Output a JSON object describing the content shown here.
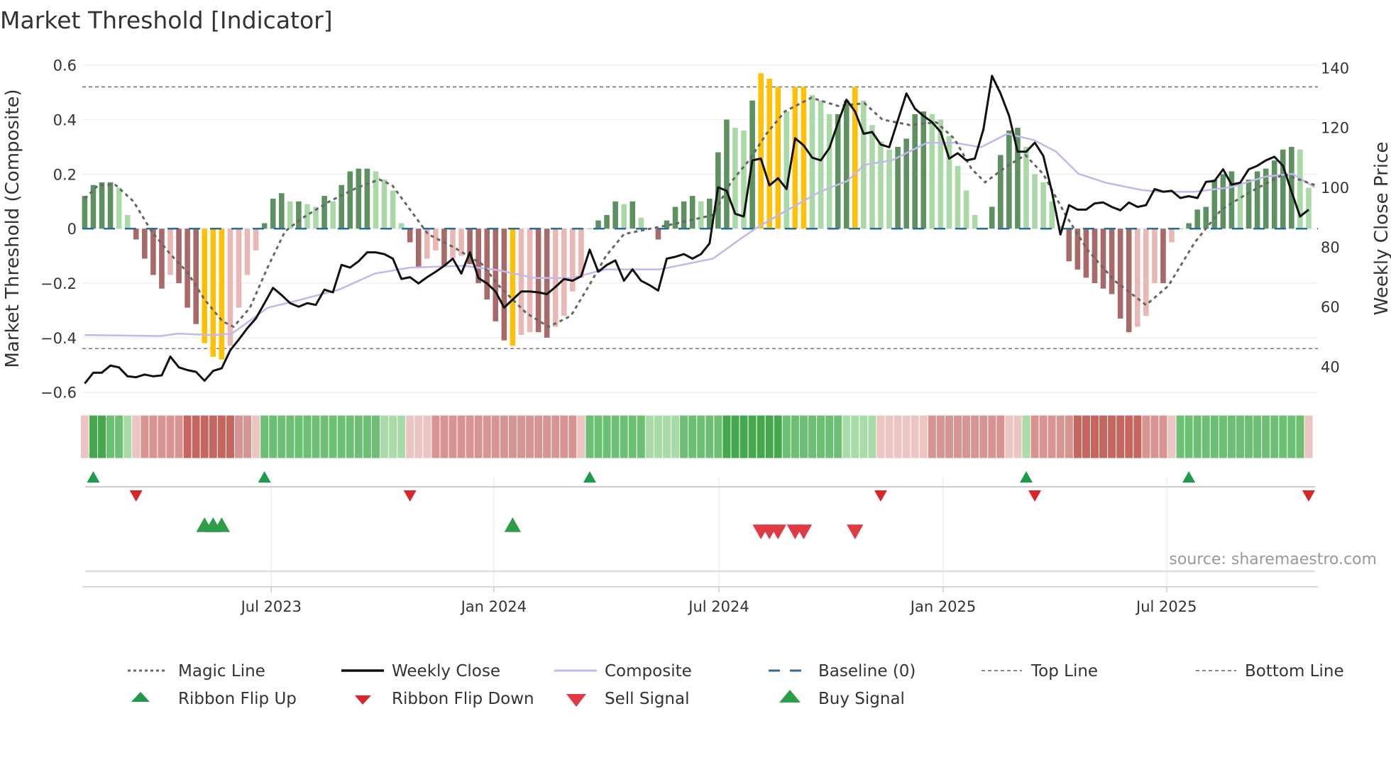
{
  "chart_data": {
    "type": "bar",
    "title": "Market Threshold [Indicator]",
    "ylabel_left": "Market Threshold (Composite)",
    "ylabel_right": "Weekly Close Price",
    "ylim_left": [
      -0.6,
      0.6
    ],
    "ylim_right": [
      30,
      145
    ],
    "yticks_left": [
      {
        "value": 0.6,
        "label": "0.6"
      },
      {
        "value": 0.4,
        "label": "0.4"
      },
      {
        "value": 0.2,
        "label": "0.2"
      },
      {
        "value": 0,
        "label": "0"
      },
      {
        "value": -0.2,
        "label": "−0.2"
      },
      {
        "value": -0.4,
        "label": "−0.4"
      },
      {
        "value": -0.6,
        "label": "−0.6"
      }
    ],
    "yticks_right": [
      {
        "value": 140,
        "label": "140"
      },
      {
        "value": 120,
        "label": "120"
      },
      {
        "value": 100,
        "label": "100"
      },
      {
        "value": 80,
        "label": "80"
      },
      {
        "value": 60,
        "label": "60"
      },
      {
        "value": 40,
        "label": "40"
      }
    ],
    "x_unit": "week index",
    "x_ticks": [
      {
        "week": 21.8,
        "label": "Jul 2023"
      },
      {
        "week": 47.8,
        "label": "Jan 2024"
      },
      {
        "week": 74.1,
        "label": "Jul 2024"
      },
      {
        "week": 100.3,
        "label": "Jan 2025"
      },
      {
        "week": 126.4,
        "label": "Jul 2025"
      }
    ],
    "top_line": 0.52,
    "bottom_line": -0.44,
    "baseline": 0,
    "histogram": [
      0.12,
      0.16,
      0.17,
      0.17,
      0.15,
      0.05,
      -0.04,
      -0.11,
      -0.17,
      -0.22,
      -0.17,
      -0.2,
      -0.29,
      -0.35,
      -0.42,
      -0.47,
      -0.48,
      -0.43,
      -0.29,
      -0.17,
      -0.08,
      0.02,
      0.11,
      0.13,
      0.1,
      0.1,
      0.09,
      0.08,
      0.12,
      0.1,
      0.16,
      0.21,
      0.22,
      0.22,
      0.21,
      0.18,
      0.14,
      0.02,
      -0.05,
      -0.14,
      -0.11,
      -0.08,
      -0.14,
      -0.11,
      -0.1,
      -0.13,
      -0.2,
      -0.26,
      -0.34,
      -0.41,
      -0.43,
      -0.39,
      -0.38,
      -0.38,
      -0.4,
      -0.36,
      -0.32,
      -0.23,
      -0.18,
      0,
      0.03,
      0.05,
      0.1,
      0.09,
      0.1,
      0.04,
      0,
      -0.04,
      0.03,
      0.08,
      0.1,
      0.12,
      0.1,
      0.11,
      0.28,
      0.4,
      0.37,
      0.36,
      0.47,
      0.57,
      0.55,
      0.52,
      0.43,
      0.52,
      0.52,
      0.49,
      0.47,
      0.42,
      0.42,
      0.47,
      0.52,
      0.47,
      0.38,
      0.32,
      0.29,
      0.3,
      0.33,
      0.42,
      0.43,
      0.42,
      0.4,
      0.34,
      0.23,
      0.14,
      0.05,
      0,
      0.08,
      0.27,
      0.36,
      0.37,
      0.3,
      0.2,
      0.17,
      0.1,
      0.01,
      -0.12,
      -0.15,
      -0.18,
      -0.2,
      -0.22,
      -0.24,
      -0.33,
      -0.38,
      -0.36,
      -0.32,
      -0.2,
      -0.2,
      -0.05,
      0,
      0.02,
      0.07,
      0.08,
      0.18,
      0.2,
      0.21,
      0.17,
      0.18,
      0.21,
      0.22,
      0.25,
      0.29,
      0.3,
      0.29,
      0.15
    ],
    "highlight_weeks": [
      14,
      15,
      16,
      50,
      79,
      80,
      81,
      83,
      84,
      90
    ],
    "weekly_close": [
      34.3,
      37.9,
      37.9,
      40.3,
      39.7,
      36.7,
      36.4,
      37.3,
      36.7,
      37.0,
      43.3,
      39.7,
      38.8,
      38.2,
      35.2,
      38.5,
      39.4,
      45.4,
      49.0,
      52.8,
      56.1,
      61.2,
      66.3,
      63.9,
      61.2,
      60.0,
      61.2,
      60.6,
      65.7,
      64.8,
      74.0,
      73.1,
      75.2,
      78.2,
      78.2,
      77.6,
      76.1,
      69.3,
      69.9,
      67.8,
      69.9,
      71.7,
      73.7,
      76.1,
      71.1,
      78.2,
      69.6,
      67.8,
      65.1,
      59.7,
      62.4,
      65.1,
      65.1,
      64.8,
      64.2,
      66.6,
      69.3,
      68.7,
      70.2,
      79.1,
      71.7,
      74.0,
      75.5,
      68.7,
      72.5,
      68.7,
      67.2,
      65.4,
      76.1,
      76.7,
      77.6,
      76.1,
      77.6,
      81.2,
      100.0,
      98.8,
      91.1,
      90.2,
      109.0,
      109.6,
      100.6,
      103.0,
      99.4,
      116.4,
      114.0,
      109.9,
      109.0,
      113.1,
      121.5,
      129.3,
      125.4,
      117.9,
      118.5,
      114.3,
      113.4,
      122.4,
      131.4,
      126.3,
      123.9,
      121.8,
      118.5,
      109.6,
      111.4,
      109.0,
      109.6,
      119.4,
      137.3,
      131.4,
      123.9,
      111.9,
      111.9,
      114.9,
      110.5,
      98.5,
      84.2,
      94.0,
      92.5,
      92.5,
      94.6,
      94.9,
      93.4,
      92.3,
      94.9,
      93.4,
      94.0,
      99.4,
      98.5,
      98.8,
      96.4,
      97.0,
      96.4,
      101.8,
      102.1,
      106.0,
      100.9,
      101.5,
      106.0,
      107.2,
      109.0,
      110.2,
      107.2,
      98.5,
      90.2,
      92.5
    ],
    "composite_line": [
      [
        0,
        50.5
      ],
      [
        8.9,
        50.2
      ],
      [
        10.9,
        51.0
      ],
      [
        15.1,
        50.5
      ],
      [
        17.2,
        51.0
      ],
      [
        21.4,
        59.7
      ],
      [
        24.5,
        61.8
      ],
      [
        29.7,
        65.7
      ],
      [
        33.9,
        71.1
      ],
      [
        38,
        73.1
      ],
      [
        44.3,
        73.7
      ],
      [
        48.4,
        72.2
      ],
      [
        52.6,
        69.6
      ],
      [
        56.8,
        69.6
      ],
      [
        60.9,
        72.5
      ],
      [
        67.2,
        72.5
      ],
      [
        73.4,
        76.1
      ],
      [
        76.6,
        82.7
      ],
      [
        78.6,
        86.6
      ],
      [
        81.8,
        91.9
      ],
      [
        85.9,
        98.5
      ],
      [
        89.1,
        102.1
      ],
      [
        91.1,
        107.5
      ],
      [
        94.3,
        109.0
      ],
      [
        98.4,
        114.9
      ],
      [
        101.6,
        114.9
      ],
      [
        104.7,
        113.4
      ],
      [
        107.8,
        117.9
      ],
      [
        110.9,
        115.8
      ],
      [
        113.5,
        111.9
      ],
      [
        116.1,
        104.5
      ],
      [
        119.3,
        101.5
      ],
      [
        123.4,
        99.1
      ],
      [
        125.5,
        98.5
      ],
      [
        129.7,
        98.5
      ],
      [
        133.9,
        100.0
      ],
      [
        138,
        103.6
      ],
      [
        141.1,
        104.5
      ],
      [
        143.7,
        100.0
      ]
    ],
    "magic_line": [
      [
        0,
        0.11
      ],
      [
        1.6,
        0.16
      ],
      [
        3.6,
        0.16
      ],
      [
        5.7,
        0.1
      ],
      [
        7.8,
        -0.01
      ],
      [
        9.9,
        -0.09
      ],
      [
        12,
        -0.16
      ],
      [
        14,
        -0.26
      ],
      [
        16.1,
        -0.34
      ],
      [
        17.4,
        -0.36
      ],
      [
        19.3,
        -0.29
      ],
      [
        21.4,
        -0.14
      ],
      [
        23.4,
        -0.01
      ],
      [
        25.5,
        0.04
      ],
      [
        28.6,
        0.1
      ],
      [
        31.8,
        0.15
      ],
      [
        34.4,
        0.18
      ],
      [
        35.9,
        0.16
      ],
      [
        38,
        0.07
      ],
      [
        40.1,
        -0.02
      ],
      [
        43.2,
        -0.07
      ],
      [
        46.4,
        -0.13
      ],
      [
        48.4,
        -0.21
      ],
      [
        51.6,
        -0.31
      ],
      [
        54.2,
        -0.36
      ],
      [
        56.8,
        -0.32
      ],
      [
        58.9,
        -0.21
      ],
      [
        60.9,
        -0.1
      ],
      [
        63,
        -0.02
      ],
      [
        66.1,
        0
      ],
      [
        69.3,
        0.02
      ],
      [
        73.4,
        0.05
      ],
      [
        75.5,
        0.17
      ],
      [
        77.6,
        0.25
      ],
      [
        79.7,
        0.35
      ],
      [
        81.8,
        0.43
      ],
      [
        84.9,
        0.48
      ],
      [
        88,
        0.45
      ],
      [
        91.1,
        0.46
      ],
      [
        93.2,
        0.4
      ],
      [
        96.4,
        0.38
      ],
      [
        99.5,
        0.39
      ],
      [
        101.6,
        0.33
      ],
      [
        103.6,
        0.22
      ],
      [
        105.2,
        0.17
      ],
      [
        107.8,
        0.23
      ],
      [
        109.9,
        0.27
      ],
      [
        112,
        0.2
      ],
      [
        114.6,
        0.05
      ],
      [
        117.2,
        -0.08
      ],
      [
        120.3,
        -0.19
      ],
      [
        124,
        -0.28
      ],
      [
        126.6,
        -0.21
      ],
      [
        129.7,
        -0.05
      ],
      [
        132.8,
        0.07
      ],
      [
        135.9,
        0.13
      ],
      [
        140.1,
        0.2
      ],
      [
        143.7,
        0.16
      ]
    ],
    "ribbon": [
      -1,
      3,
      3,
      2,
      2,
      1,
      -1,
      -2,
      -2,
      -2,
      -2,
      -2,
      -3,
      -3,
      -3,
      -3,
      -3,
      -3,
      -2,
      -2,
      -1,
      2,
      2,
      2,
      2,
      2,
      2,
      2,
      2,
      2,
      2,
      2,
      2,
      2,
      2,
      1,
      1,
      1,
      -1,
      -1,
      -1,
      -2,
      -2,
      -2,
      -2,
      -2,
      -2,
      -2,
      -2,
      -2,
      -2,
      -2,
      -2,
      -2,
      -2,
      -2,
      -2,
      -2,
      -1,
      2,
      2,
      2,
      2,
      2,
      2,
      2,
      1,
      1,
      1,
      1,
      2,
      2,
      2,
      2,
      2,
      3,
      3,
      3,
      3,
      3,
      3,
      3,
      2,
      2,
      2,
      2,
      2,
      2,
      2,
      1,
      1,
      1,
      1,
      -1,
      -1,
      -1,
      -1,
      -1,
      -1,
      -2,
      -2,
      -2,
      -2,
      -2,
      -2,
      -2,
      -2,
      -2,
      -1,
      -1,
      1,
      -2,
      -2,
      -2,
      -2,
      -2,
      -3,
      -3,
      -3,
      -3,
      -3,
      -3,
      -3,
      -3,
      -2,
      -2,
      -2,
      -1,
      2,
      2,
      2,
      2,
      2,
      2,
      2,
      2,
      2,
      2,
      2,
      2,
      2,
      2,
      2,
      -1
    ],
    "ribbon_flip_up": [
      1,
      21,
      59,
      110,
      129
    ],
    "ribbon_flip_down": [
      6,
      38,
      93,
      111,
      143
    ],
    "buy_signal": [
      14,
      15,
      16,
      50
    ],
    "sell_signal": [
      79,
      80,
      81,
      83,
      84,
      90
    ],
    "legend": {
      "magic": "Magic Line",
      "close": "Weekly Close",
      "composite": "Composite",
      "baseline": "Baseline (0)",
      "top": "Top Line",
      "bottom": "Bottom Line",
      "flip_up": "Ribbon Flip Up",
      "flip_down": "Ribbon Flip Down",
      "sell": "Sell Signal",
      "buy": "Buy Signal"
    },
    "legend_placement": "bottom",
    "source": "source: sharemaestro.com",
    "colors": {
      "pos_strong": "#5e9160",
      "pos_weak": "#aad8a6",
      "neg_strong": "#a86a68",
      "neg_weak": "#eab8b4",
      "highlight": "#ffc107",
      "close": "#111111",
      "composite": "#c3b8ec",
      "magic": "#666666",
      "baseline": "#2a6f97",
      "up": "#1f9a48",
      "down": "#d9262b",
      "sell": "#e03a45",
      "buy": "#2e9d4a",
      "ribbon": {
        "3": "#45a84f",
        "2": "#6cbf73",
        "1": "#a9dba9",
        "-1": "#ecc5c3",
        "-2": "#d89490",
        "-3": "#c7655f"
      }
    }
  }
}
